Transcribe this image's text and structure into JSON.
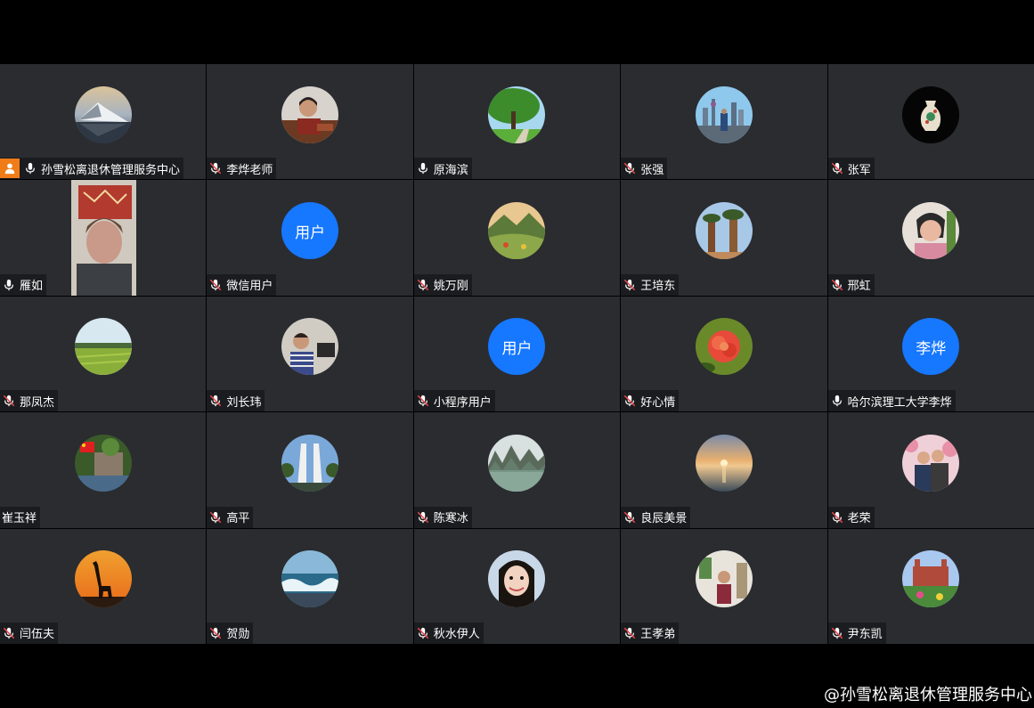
{
  "participants": [
    {
      "name": "孙雪松离退休管理服务中心",
      "mic": "on",
      "host": true,
      "avatar": "photo",
      "avatar_desc": "mountain-lake-photo"
    },
    {
      "name": "李烨老师",
      "mic": "muted",
      "avatar": "photo",
      "avatar_desc": "person-portrait-photo"
    },
    {
      "name": "原海滨",
      "mic": "on",
      "avatar": "photo",
      "avatar_desc": "tree-park-photo"
    },
    {
      "name": "张强",
      "mic": "muted",
      "avatar": "photo",
      "avatar_desc": "city-skyline-photo"
    },
    {
      "name": "张军",
      "mic": "muted",
      "avatar": "photo",
      "avatar_desc": "porcelain-vase-photo"
    },
    {
      "name": "雁如",
      "mic": "on",
      "avatar": "video",
      "avatar_desc": "live-video-feed"
    },
    {
      "name": "微信用户",
      "mic": "muted",
      "avatar": "text",
      "avatar_text": "用户"
    },
    {
      "name": "姚万刚",
      "mic": "muted",
      "avatar": "photo",
      "avatar_desc": "mountain-valley-photo"
    },
    {
      "name": "王培东",
      "mic": "muted",
      "avatar": "photo",
      "avatar_desc": "baobab-trees-photo"
    },
    {
      "name": "邢虹",
      "mic": "muted",
      "avatar": "photo",
      "avatar_desc": "woman-portrait-photo"
    },
    {
      "name": "那凤杰",
      "mic": "muted",
      "avatar": "photo",
      "avatar_desc": "green-field-photo"
    },
    {
      "name": "刘长玮",
      "mic": "muted",
      "avatar": "photo",
      "avatar_desc": "man-at-desk-photo"
    },
    {
      "name": "小程序用户",
      "mic": "muted",
      "avatar": "text",
      "avatar_text": "用户"
    },
    {
      "name": "好心情",
      "mic": "muted",
      "avatar": "photo",
      "avatar_desc": "red-flower-photo"
    },
    {
      "name": "哈尔滨理工大学李烨",
      "mic": "on",
      "avatar": "text",
      "avatar_text": "李烨"
    },
    {
      "name": "崔玉祥",
      "mic": "none",
      "avatar": "photo",
      "avatar_desc": "garden-flag-photo"
    },
    {
      "name": "高平",
      "mic": "muted",
      "avatar": "photo",
      "avatar_desc": "monument-photo"
    },
    {
      "name": "陈寒冰",
      "mic": "muted",
      "avatar": "photo",
      "avatar_desc": "karst-mountains-photo"
    },
    {
      "name": "良辰美景",
      "mic": "muted",
      "avatar": "photo",
      "avatar_desc": "sunset-sea-photo"
    },
    {
      "name": "老荣",
      "mic": "muted",
      "avatar": "photo",
      "avatar_desc": "couple-blossoms-photo"
    },
    {
      "name": "闫伍夫",
      "mic": "muted",
      "avatar": "photo",
      "avatar_desc": "giraffe-sunset-photo"
    },
    {
      "name": "贺勋",
      "mic": "muted",
      "avatar": "photo",
      "avatar_desc": "ocean-waves-photo"
    },
    {
      "name": "秋水伊人",
      "mic": "muted",
      "avatar": "photo",
      "avatar_desc": "woman-smiling-photo"
    },
    {
      "name": "王孝弟",
      "mic": "muted",
      "avatar": "photo",
      "avatar_desc": "woman-room-photo"
    },
    {
      "name": "尹东凯",
      "mic": "muted",
      "avatar": "photo",
      "avatar_desc": "castle-garden-photo"
    }
  ],
  "watermark": "@孙雪松离退休管理服务中心",
  "colors": {
    "tile_bg": "#2a2c30",
    "avatar_text_bg": "#1677ff",
    "host_badge": "#f07c18",
    "muted_slash": "#e5484d"
  }
}
